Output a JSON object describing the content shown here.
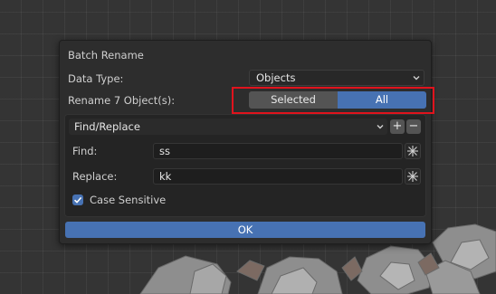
{
  "dialog": {
    "title": "Batch Rename",
    "data_type_label": "Data Type:",
    "data_type_value": "Objects",
    "rename_label": "Rename 7 Object(s):",
    "scope": {
      "options": [
        "Selected",
        "All"
      ],
      "selected": "All"
    },
    "action": {
      "type_value": "Find/Replace",
      "find_label": "Find:",
      "find_value": "ss",
      "replace_label": "Replace:",
      "replace_value": "kk",
      "case_sensitive_label": "Case Sensitive",
      "case_sensitive_checked": true,
      "add_symbol": "+",
      "remove_symbol": "−"
    },
    "ok_label": "OK"
  },
  "colors": {
    "accent": "#4772b3",
    "highlight_box": "#e0131d",
    "dialog_bg": "#2d2d2d"
  },
  "icons": [
    "chevron-down-icon",
    "eyedropper-icon",
    "checkmark-icon",
    "plus-icon",
    "minus-icon"
  ]
}
